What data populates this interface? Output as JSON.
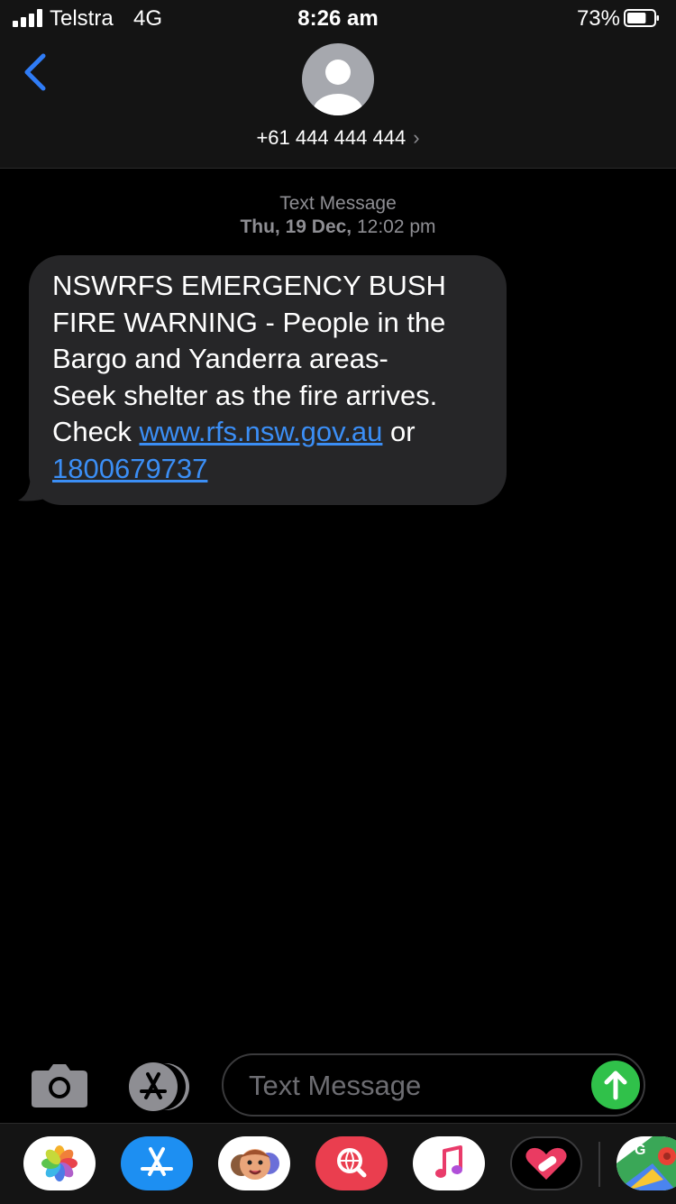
{
  "status_bar": {
    "carrier": "Telstra",
    "network": "4G",
    "time": "8:26 am",
    "battery_percent": "73%",
    "battery_level": 0.73
  },
  "header": {
    "contact": "+61 444 444 444",
    "chevron": "›",
    "back_icon": "chevron-left-icon"
  },
  "thread": {
    "service_label": "Text Message",
    "date_bold": "Thu, 19 Dec,",
    "time": " 12:02 pm",
    "message": {
      "line1": "NSWRFS EMERGENCY BUSH",
      "line2": "FIRE WARNING - People in the",
      "line3": "Bargo and Yanderra areas-",
      "line4": "Seek shelter as the fire arrives.",
      "check_prefix": "Check ",
      "link_url": "www.rfs.nsw.gov.au",
      "or": " or",
      "link_phone": "1800679737"
    }
  },
  "compose": {
    "placeholder": "Text Message",
    "value": ""
  },
  "app_drawer": {
    "apps": [
      "photos",
      "app-store",
      "memoji",
      "web-images",
      "music",
      "heart-stickers",
      "google-maps"
    ]
  },
  "colors": {
    "background": "#000000",
    "bar": "#141414",
    "bubble": "#262628",
    "link": "#3b8ef5",
    "back": "#2f7cf6",
    "send": "#30c14a",
    "meta": "#8e8e93"
  }
}
